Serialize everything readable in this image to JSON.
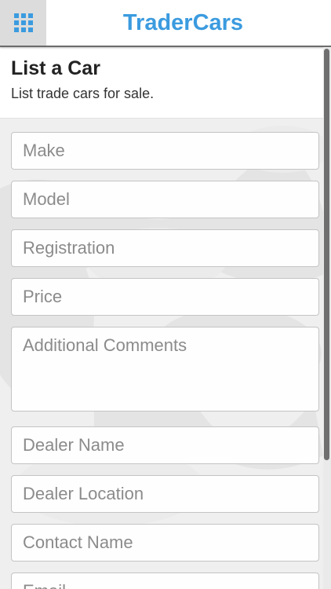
{
  "app": {
    "title": "TraderCars"
  },
  "header": {
    "title": "List a Car",
    "subtitle": "List trade cars for sale."
  },
  "form": {
    "make_placeholder": "Make",
    "model_placeholder": "Model",
    "registration_placeholder": "Registration",
    "price_placeholder": "Price",
    "comments_placeholder": "Additional Comments",
    "dealer_name_placeholder": "Dealer Name",
    "dealer_location_placeholder": "Dealer Location",
    "contact_name_placeholder": "Contact Name",
    "email_placeholder": "Email"
  },
  "icons": {
    "menu": "apps-grid-icon"
  },
  "colors": {
    "brand": "#3b9bdf"
  }
}
